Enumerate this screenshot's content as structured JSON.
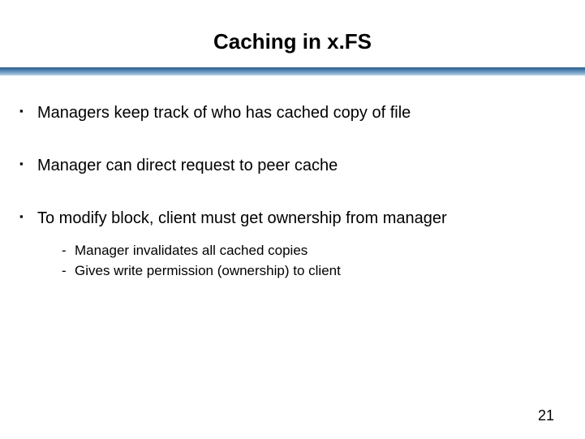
{
  "title": "Caching in x.FS",
  "bullets": [
    {
      "text": "Managers keep track of who has cached copy of file",
      "sub": []
    },
    {
      "text": "Manager can direct request to peer cache",
      "sub": []
    },
    {
      "text": "To modify block, client must get ownership from manager",
      "sub": [
        "Manager invalidates all cached copies",
        "Gives write permission (ownership) to client"
      ]
    }
  ],
  "page_number": "21"
}
